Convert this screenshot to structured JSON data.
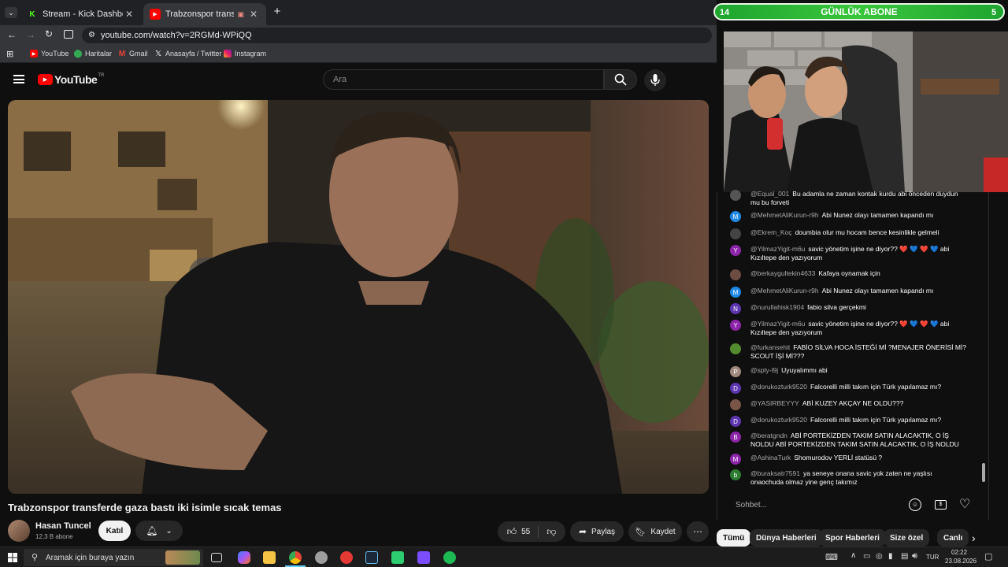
{
  "browser": {
    "tabs": [
      {
        "title": "Stream - Kick Dashboard",
        "favicon": "K",
        "color": "#53fc18",
        "active": false
      },
      {
        "title": "Trabzonspor transferde gaz",
        "favicon": "▶",
        "color": "#ff0000",
        "active": true
      }
    ],
    "url": "youtube.com/watch?v=2RGMd-WPiQQ",
    "bookmarks": [
      "YouTube",
      "Haritalar",
      "Gmail",
      "Anasayfa / Twitter",
      "Instagram"
    ]
  },
  "youtube": {
    "logo_text": "YouTube",
    "logo_region": "TR",
    "search_placeholder": "Ara",
    "video_title": "Trabzonspor transferde gaza bastı iki isimle sıcak temas",
    "channel_name": "Hasan Tuncel",
    "subscribers": "12,3 B abone",
    "join_label": "Katıl",
    "likes": "55",
    "share_label": "Paylaş",
    "save_label": "Kaydet"
  },
  "overlay": {
    "abone_left": "14",
    "abone_title": "GÜNLÜK ABONE",
    "abone_right": "5",
    "accent": "#2fb63a"
  },
  "chat": {
    "messages": [
      {
        "user": "@Equal_001",
        "text": "Bu adamla ne zaman kontak kurdu abi önceden duydun mu bu forveti",
        "avatar": "",
        "color": "#555555"
      },
      {
        "user": "@MehmetAliKurun-r9h",
        "text": "Abi Nunez olayı tamamen kapandı mı",
        "avatar": "M",
        "color": "#1e88e5"
      },
      {
        "user": "@Ekrem_Koç",
        "text": "doumbia olur mu hocam bence kesinlikle gelmeli",
        "avatar": "",
        "color": "#444444"
      },
      {
        "user": "@YilmazYigit-m6u",
        "text": "savic yönetim işine ne diyor?? ❤️ 💙 ❤️ 💙 abi Kızıltepe den yazıyorum",
        "avatar": "Y",
        "color": "#8e24aa"
      },
      {
        "user": "@berkaygultekin4633",
        "text": "Kafaya oynamak için",
        "avatar": "",
        "color": "#6d4c41"
      },
      {
        "user": "@MehmetAliKurun-r9h",
        "text": "Abi Nunez olayı tamamen kapandı mı",
        "avatar": "M",
        "color": "#1e88e5"
      },
      {
        "user": "@nurullahisk1904",
        "text": "fabio silva gerçekmi",
        "avatar": "N",
        "color": "#5e35b1"
      },
      {
        "user": "@YilmazYigit-m6u",
        "text": "savic yönetim işine ne diyor?? ❤️ 💙 ❤️ 💙 abi Kızıltepe den yazıyorum",
        "avatar": "Y",
        "color": "#8e24aa"
      },
      {
        "user": "@furkansehit",
        "text": "FABİO SİLVA HOCA İSTEĞİ Mİ ?MENAJER ÖNERİSİ Mİ? SCOUT İŞİ Mİ???",
        "avatar": "",
        "color": "#558b2f"
      },
      {
        "user": "@sply-l9j",
        "text": "Uyuyalımmı abi",
        "avatar": "P",
        "color": "#a1887f"
      },
      {
        "user": "@dorukozturk9520",
        "text": "Falcorelli milli takım için Türk yapılamaz mı?",
        "avatar": "D",
        "color": "#5e35b1"
      },
      {
        "user": "@YASIRBEYYY",
        "text": "ABİ KUZEY AKÇAY NE OLDU???",
        "avatar": "",
        "color": "#795548"
      },
      {
        "user": "@dorukozturk9520",
        "text": "Falcorelli milli takım için Türk yapılamaz mı?",
        "avatar": "D",
        "color": "#5e35b1"
      },
      {
        "user": "@beratgndn",
        "text": "ABİ PORTEKİZDEN TAKIM SATIN ALACAKTIK, O İŞ NOLDU ABİ PORTEKİZDEN TAKIM SATIN ALACAKTIK, O İŞ NOLDU",
        "avatar": "B",
        "color": "#8e24aa"
      },
      {
        "user": "@AshinaTurk",
        "text": "Shomurodov YERLİ statüsü ?",
        "avatar": "M",
        "color": "#8e24aa"
      },
      {
        "user": "@buraksatr7591",
        "text": "ya seneye onana savic yok zaten ne yaşlısı onaochuda olmaz yine genç takımız",
        "avatar": "b",
        "color": "#2e7d32"
      }
    ],
    "input_placeholder": "Sohbet...",
    "chips": [
      "Tümü",
      "Dünya Haberleri",
      "Spor Haberleri",
      "Size özel",
      "Canlı"
    ]
  },
  "taskbar": {
    "search_placeholder": "Aramak için buraya yazın",
    "language": "TUR",
    "time": "02:22",
    "date": "23.08.2026"
  }
}
